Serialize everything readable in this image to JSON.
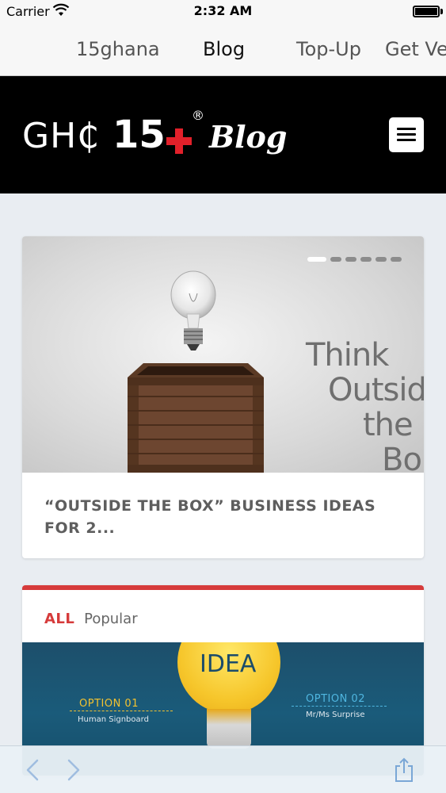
{
  "status_bar": {
    "carrier": "Carrier",
    "time": "2:32 AM"
  },
  "tabs": [
    {
      "label": "15ghana"
    },
    {
      "label": "Blog"
    },
    {
      "label": "Top-Up"
    },
    {
      "label": "Get Ve"
    }
  ],
  "header": {
    "logo_ghc": "GH₵",
    "logo_num": "15",
    "logo_reg": "®",
    "logo_blog": "Blog"
  },
  "featured": {
    "slide_count": 6,
    "active_slide": 1,
    "hero_text": [
      "Think",
      "Outside",
      "the",
      "Bo"
    ],
    "title": "“OUTSIDE THE BOX” BUSINESS IDEAS FOR 2..."
  },
  "popular_section": {
    "filter_all": "ALL",
    "filter_popular": "Popular",
    "image_text": {
      "idea": "IDEA",
      "option1": "OPTION 01",
      "option1_sub": "Human Signboard",
      "option2": "OPTION 02",
      "option2_sub": "Mr/Ms Surprise"
    }
  },
  "colors": {
    "accent_red": "#d63b3b",
    "header_bg": "#000000",
    "ios_blue": "#7aa7d6"
  },
  "icons": {
    "back": "chevron-left-icon",
    "forward": "chevron-right-icon",
    "share": "share-icon",
    "menu": "hamburger-menu-icon",
    "wifi": "wifi-icon",
    "battery": "battery-icon"
  }
}
